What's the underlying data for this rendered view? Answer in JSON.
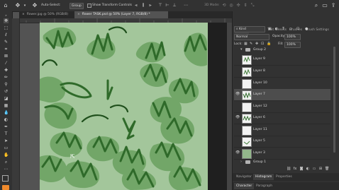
{
  "options_bar": {
    "auto_select_label": "Auto-Select:",
    "auto_select_value": "Group",
    "show_transform_label": "Show Transform Controls",
    "mode_3d_label": "3D Mode:",
    "search_icon": "search-icon",
    "workspace_icon": "workspace-icon",
    "share_icon": "share-icon"
  },
  "document_tabs": [
    {
      "label": "flower.jpg @ 50% (RGB/8)",
      "active": false
    },
    {
      "label": "flower TASK.psd @ 50% (Layer 7, RGB/8) *",
      "active": true
    }
  ],
  "panel_tabs": [
    "Layers",
    "History",
    "Text Presets",
    "Brushes",
    "Brush Settings"
  ],
  "layers_panel": {
    "filter_label": "Kind",
    "blend_mode": "Normal",
    "opacity_label": "Opacity:",
    "opacity_value": "100%",
    "lock_label": "Lock:",
    "fill_label": "Fill:",
    "fill_value": "100%",
    "group_top": "Group 2",
    "layers": [
      {
        "name": "Layer 9",
        "visible": false,
        "selected": false
      },
      {
        "name": "Layer 8",
        "visible": false,
        "selected": false
      },
      {
        "name": "Layer 10",
        "visible": false,
        "selected": false
      },
      {
        "name": "Layer 7",
        "visible": true,
        "selected": true
      },
      {
        "name": "Layer 12",
        "visible": false,
        "selected": false
      },
      {
        "name": "Layer 6",
        "visible": true,
        "selected": false
      },
      {
        "name": "Layer 11",
        "visible": false,
        "selected": false
      },
      {
        "name": "Layer 5",
        "visible": false,
        "selected": false
      },
      {
        "name": "Layer 3",
        "visible": true,
        "selected": false
      }
    ],
    "group_bottom": "Group 1"
  },
  "lower_tabs_1": [
    "Navigator",
    "Histogram",
    "Properties"
  ],
  "lower_tabs_2": [
    "Character",
    "Paragraph"
  ]
}
